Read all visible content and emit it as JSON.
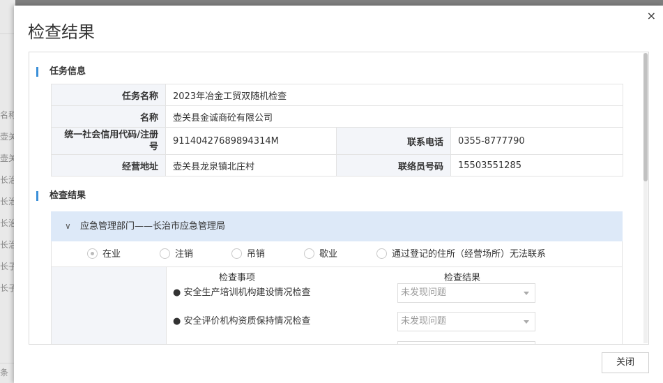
{
  "background": {
    "rows": [
      "名称",
      "壶关",
      "壶关",
      "长治",
      "长治",
      "长治",
      "长治",
      "长子",
      "长子"
    ],
    "bottom_text": "条"
  },
  "modal": {
    "title": "检查结果",
    "close_icon": "×",
    "close_button_label": "关闭"
  },
  "task_info": {
    "section_title": "任务信息",
    "task_name_label": "任务名称",
    "task_name_value": "2023年冶金工贸双随机检查",
    "name_label": "名称",
    "name_value": "壶关县金诚商砼有限公司",
    "credit_code_label": "统一社会信用代码/注册号",
    "credit_code_value": "91140427689894314M",
    "phone_label": "联系电话",
    "phone_value": "0355-8777790",
    "address_label": "经营地址",
    "address_value": "壶关县龙泉镇北庄村",
    "liaison_label": "联络员号码",
    "liaison_value": "15503551285"
  },
  "check_result": {
    "section_title": "检查结果",
    "department": "应急管理部门——长治市应急管理局",
    "status_options": [
      {
        "label": "在业",
        "selected": true
      },
      {
        "label": "注销",
        "selected": false
      },
      {
        "label": "吊销",
        "selected": false
      },
      {
        "label": "歇业",
        "selected": false
      },
      {
        "label": "通过登记的住所（经营场所）无法联系",
        "selected": false
      }
    ],
    "col_item_header": "检查事项",
    "col_result_header": "检查结果",
    "items": [
      {
        "name": "● 安全生产培训机构建设情况检查",
        "result": "未发现问题"
      },
      {
        "name": "● 安全评价机构资质保持情况检查",
        "result": "未发现问题"
      }
    ]
  }
}
